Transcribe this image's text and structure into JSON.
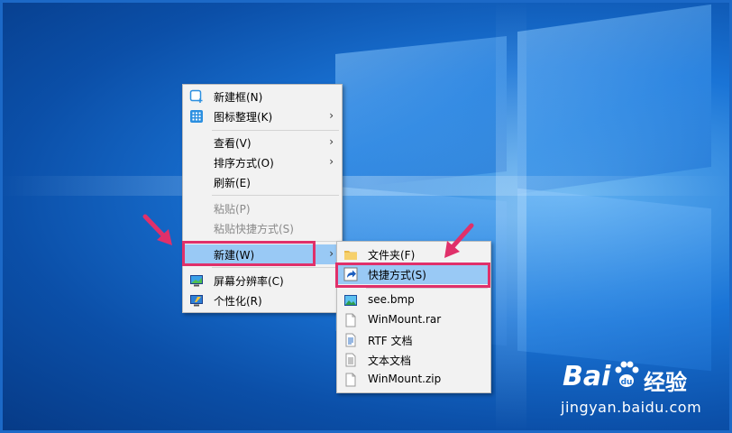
{
  "context_menu": {
    "items": [
      {
        "label": "新建框(N)",
        "icon": "new-box-icon"
      },
      {
        "label": "图标整理(K)",
        "icon": "icon-arrange-icon",
        "arrow": "›"
      },
      {
        "label": "查看(V)",
        "arrow": "›"
      },
      {
        "label": "排序方式(O)",
        "arrow": "›"
      },
      {
        "label": "刷新(E)"
      },
      {
        "label": "粘贴(P)",
        "disabled": true
      },
      {
        "label": "粘贴快捷方式(S)",
        "disabled": true
      },
      {
        "label": "新建(W)",
        "arrow": "›",
        "highlighted": true
      },
      {
        "label": "屏幕分辨率(C)",
        "icon": "display-settings-icon"
      },
      {
        "label": "个性化(R)",
        "icon": "personalize-icon"
      }
    ]
  },
  "submenu_new": {
    "items": [
      {
        "label": "文件夹(F)",
        "icon": "folder-icon"
      },
      {
        "label": "快捷方式(S)",
        "icon": "shortcut-icon",
        "highlighted": true
      },
      {
        "label": "see.bmp",
        "icon": "bitmap-icon"
      },
      {
        "label": "WinMount.rar",
        "icon": "file-icon"
      },
      {
        "label": "RTF 文档",
        "icon": "rtf-document-icon"
      },
      {
        "label": "文本文档",
        "icon": "text-document-icon"
      },
      {
        "label": "WinMount.zip",
        "icon": "file-icon"
      }
    ]
  },
  "watermark": {
    "brand": "Bai",
    "brand2": "百度",
    "product": "经验",
    "url": "jingyan.baidu.com"
  },
  "colors": {
    "highlight": "#99c9f5",
    "annotation": "#e0306a",
    "menu_bg": "#f2f2f2"
  }
}
